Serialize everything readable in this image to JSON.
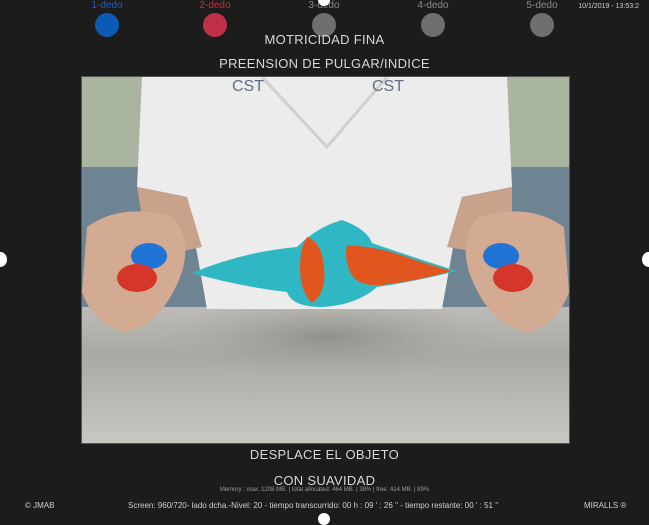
{
  "fingers": [
    {
      "label": "1-dedo",
      "label_color": "#1f5fbf",
      "dot_color": "#0b5bb5"
    },
    {
      "label": "2-dedo",
      "label_color": "#c0303f",
      "dot_color": "#c0304a"
    },
    {
      "label": "3-dedo",
      "label_color": "#8a8a8a",
      "dot_color": "#6f6f6f"
    },
    {
      "label": "4-dedo",
      "label_color": "#8a8a8a",
      "dot_color": "#6f6f6f"
    },
    {
      "label": "5-dedo",
      "label_color": "#8a8a8a",
      "dot_color": "#6f6f6f"
    }
  ],
  "timestamp": "10/1/2019 - 13:53:2",
  "header": {
    "title": "MOTRICIDAD FINA",
    "subtitle": "PREENSION DE PULGAR/INDICE"
  },
  "instruction": {
    "line1": "DESPLACE EL OBJETO",
    "line2": "CON SUAVIDAD"
  },
  "memory_text": "Memory : max: 1208 MB. | total allocated: 464 MB. | 38% | free: 414 MB. | 89%",
  "footer": {
    "left": "© JMAB",
    "center": "Screen: 960/720- lado dcha.-Nivel: 20 - tiempo transcurrido: 00 h : 09 ' : 26 '' - tiempo restante: 00 ' : 51 ''",
    "right": "MIRALLS ®"
  }
}
